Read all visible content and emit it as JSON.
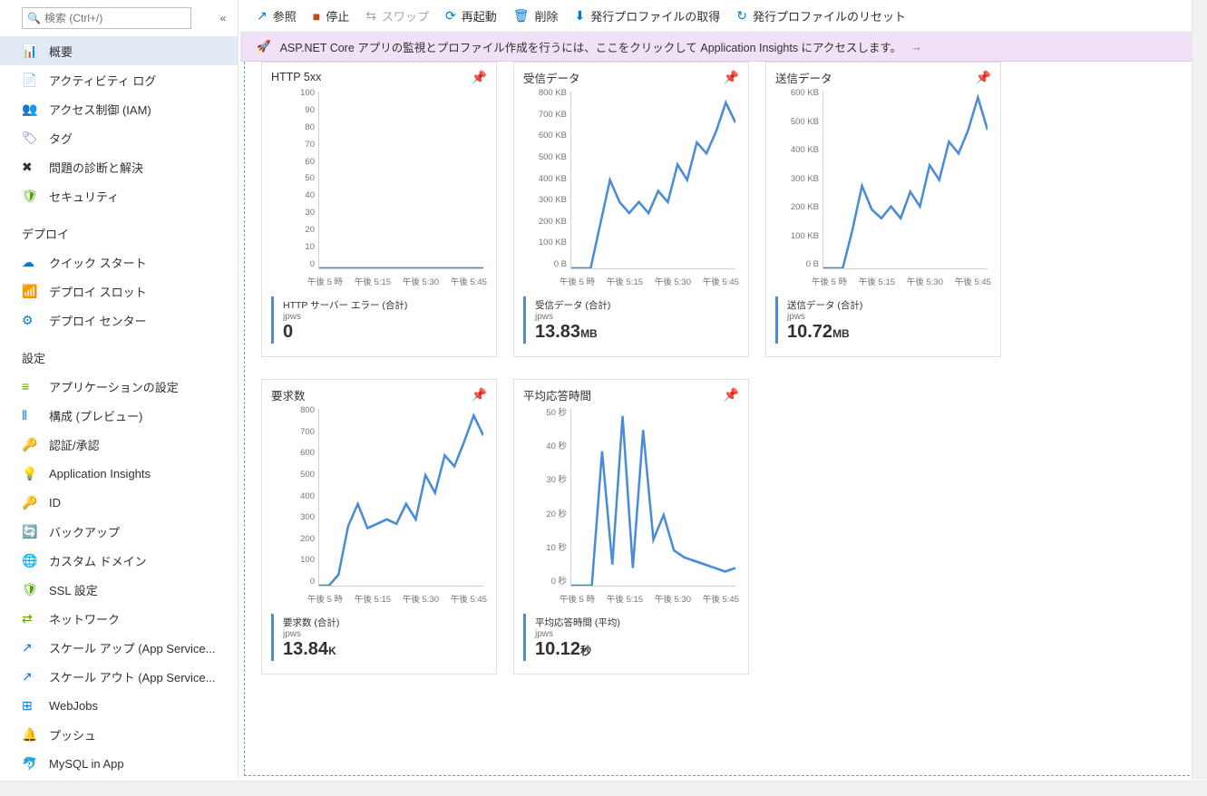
{
  "search": {
    "placeholder": "検索 (Ctrl+/)"
  },
  "sidebar": {
    "groups": [
      {
        "items": [
          {
            "icon": "📊",
            "color": "#0078d4",
            "label": "概要",
            "active": true
          },
          {
            "icon": "📄",
            "color": "#0078d4",
            "label": "アクティビティ ログ"
          },
          {
            "icon": "👥",
            "color": "#0078d4",
            "label": "アクセス制御 (IAM)"
          },
          {
            "icon": "🏷",
            "color": "#8661c5",
            "label": "タグ"
          },
          {
            "icon": "✖",
            "color": "#323130",
            "label": "問題の診断と解決"
          },
          {
            "icon": "🛡",
            "color": "#57a300",
            "label": "セキュリティ"
          }
        ]
      },
      {
        "title": "デプロイ",
        "items": [
          {
            "icon": "☁",
            "color": "#0078d4",
            "label": "クイック スタート"
          },
          {
            "icon": "📶",
            "color": "#ff8c00",
            "label": "デプロイ スロット"
          },
          {
            "icon": "⚙",
            "color": "#0078d4",
            "label": "デプロイ センター"
          }
        ]
      },
      {
        "title": "設定",
        "items": [
          {
            "icon": "≡",
            "color": "#57a300",
            "label": "アプリケーションの設定"
          },
          {
            "icon": "⦀",
            "color": "#0078d4",
            "label": "構成 (プレビュー)"
          },
          {
            "icon": "🔑",
            "color": "#ffb900",
            "label": "認証/承認"
          },
          {
            "icon": "💡",
            "color": "#8661c5",
            "label": "Application Insights"
          },
          {
            "icon": "🔑",
            "color": "#ffb900",
            "label": "ID"
          },
          {
            "icon": "🔄",
            "color": "#0078d4",
            "label": "バックアップ"
          },
          {
            "icon": "🌐",
            "color": "#0078d4",
            "label": "カスタム ドメイン"
          },
          {
            "icon": "🛡",
            "color": "#57a300",
            "label": "SSL 設定"
          },
          {
            "icon": "⇄",
            "color": "#57a300",
            "label": "ネットワーク"
          },
          {
            "icon": "↗",
            "color": "#0078d4",
            "label": "スケール アップ (App Service..."
          },
          {
            "icon": "↗",
            "color": "#0078d4",
            "label": "スケール アウト (App Service..."
          },
          {
            "icon": "⊞",
            "color": "#0078d4",
            "label": "WebJobs"
          },
          {
            "icon": "🔔",
            "color": "#ffb900",
            "label": "プッシュ"
          },
          {
            "icon": "🐬",
            "color": "#0078d4",
            "label": "MySQL in App"
          }
        ]
      }
    ]
  },
  "toolbar": {
    "browse": {
      "label": "参照"
    },
    "stop": {
      "label": "停止"
    },
    "swap": {
      "label": "スワップ",
      "disabled": true
    },
    "restart": {
      "label": "再起動"
    },
    "delete": {
      "label": "削除"
    },
    "getpub": {
      "label": "発行プロファイルの取得"
    },
    "resetpub": {
      "label": "発行プロファイルのリセット"
    }
  },
  "banner": {
    "text": "ASP.NET Core アプリの監視とプロファイル作成を行うには、ここをクリックして Application Insights にアクセスします。"
  },
  "charts": {
    "http5xx": {
      "title": "HTTP 5xx",
      "metric_label": "HTTP サーバー エラー (合計)",
      "resource": "jpws",
      "value": "0",
      "unit": ""
    },
    "datain": {
      "title": "受信データ",
      "metric_label": "受信データ (合計)",
      "resource": "jpws",
      "value": "13.83",
      "unit": "MB"
    },
    "dataout": {
      "title": "送信データ",
      "metric_label": "送信データ (合計)",
      "resource": "jpws",
      "value": "10.72",
      "unit": "MB"
    },
    "requests": {
      "title": "要求数",
      "metric_label": "要求数 (合計)",
      "resource": "jpws",
      "value": "13.84",
      "unit": "K"
    },
    "response": {
      "title": "平均応答時間",
      "metric_label": "平均応答時間 (平均)",
      "resource": "jpws",
      "value": "10.12",
      "unit": "秒"
    }
  },
  "chart_data": [
    {
      "id": "http5xx",
      "type": "line",
      "title": "HTTP 5xx",
      "ylabel": "",
      "xlabel": "",
      "ylim": [
        0,
        100
      ],
      "y_ticks": [
        100,
        90,
        80,
        70,
        60,
        50,
        40,
        30,
        20,
        10,
        0
      ],
      "x_ticks": [
        "午後 5 時",
        "午後 5:15",
        "午後 5:30",
        "午後 5:45"
      ],
      "x": [
        "17:00",
        "17:05",
        "17:10",
        "17:15",
        "17:20",
        "17:25",
        "17:30",
        "17:35",
        "17:40",
        "17:45",
        "17:50",
        "17:55"
      ],
      "values": [
        0,
        0,
        0,
        0,
        0,
        0,
        0,
        0,
        0,
        0,
        0,
        0
      ]
    },
    {
      "id": "datain",
      "type": "line",
      "title": "受信データ",
      "ylabel": "",
      "xlabel": "",
      "ylim": [
        0,
        800
      ],
      "y_ticks_labels": [
        "800 KB",
        "700 KB",
        "600 KB",
        "500 KB",
        "400 KB",
        "300 KB",
        "200 KB",
        "100 KB",
        "0 B"
      ],
      "x_ticks": [
        "午後 5 時",
        "午後 5:15",
        "午後 5:30",
        "午後 5:45"
      ],
      "x": [
        "17:00",
        "17:10",
        "17:15",
        "17:18",
        "17:20",
        "17:22",
        "17:25",
        "17:27",
        "17:30",
        "17:33",
        "17:35",
        "17:38",
        "17:40",
        "17:43",
        "17:45",
        "17:48",
        "17:50",
        "17:53"
      ],
      "values": [
        0,
        0,
        0,
        200,
        400,
        300,
        250,
        300,
        250,
        350,
        300,
        470,
        400,
        570,
        520,
        620,
        750,
        660
      ]
    },
    {
      "id": "dataout",
      "type": "line",
      "title": "送信データ",
      "ylabel": "",
      "xlabel": "",
      "ylim": [
        0,
        600
      ],
      "y_ticks_labels": [
        "600 KB",
        "500 KB",
        "400 KB",
        "300 KB",
        "200 KB",
        "100 KB",
        "0 B"
      ],
      "x_ticks": [
        "午後 5 時",
        "午後 5:15",
        "午後 5:30",
        "午後 5:45"
      ],
      "x": [
        "17:00",
        "17:10",
        "17:15",
        "17:18",
        "17:20",
        "17:22",
        "17:25",
        "17:27",
        "17:30",
        "17:33",
        "17:35",
        "17:38",
        "17:40",
        "17:43",
        "17:45",
        "17:48",
        "17:50",
        "17:53"
      ],
      "values": [
        0,
        0,
        0,
        130,
        280,
        200,
        170,
        210,
        170,
        260,
        210,
        350,
        300,
        430,
        390,
        470,
        580,
        470
      ]
    },
    {
      "id": "requests",
      "type": "line",
      "title": "要求数",
      "ylabel": "",
      "xlabel": "",
      "ylim": [
        0,
        800
      ],
      "y_ticks": [
        800,
        700,
        600,
        500,
        400,
        300,
        200,
        100,
        0
      ],
      "x_ticks": [
        "午後 5 時",
        "午後 5:15",
        "午後 5:30",
        "午後 5:45"
      ],
      "x": [
        "17:00",
        "17:10",
        "17:15",
        "17:18",
        "17:20",
        "17:22",
        "17:25",
        "17:27",
        "17:30",
        "17:33",
        "17:35",
        "17:38",
        "17:40",
        "17:43",
        "17:45",
        "17:48",
        "17:50",
        "17:53"
      ],
      "values": [
        0,
        0,
        50,
        270,
        370,
        260,
        280,
        300,
        280,
        370,
        300,
        500,
        420,
        590,
        540,
        650,
        770,
        680
      ]
    },
    {
      "id": "response",
      "type": "line",
      "title": "平均応答時間",
      "ylabel": "",
      "xlabel": "",
      "ylim": [
        0,
        50
      ],
      "y_ticks_labels": [
        "50 秒",
        "40 秒",
        "30 秒",
        "20 秒",
        "10 秒",
        "0 秒"
      ],
      "x_ticks": [
        "午後 5 時",
        "午後 5:15",
        "午後 5:30",
        "午後 5:45"
      ],
      "x": [
        "17:00",
        "17:10",
        "17:15",
        "17:17",
        "17:18",
        "17:20",
        "17:22",
        "17:24",
        "17:25",
        "17:27",
        "17:30",
        "17:33",
        "17:35",
        "17:40",
        "17:45",
        "17:50",
        "17:55"
      ],
      "values": [
        0,
        0,
        0,
        38,
        6,
        48,
        5,
        44,
        13,
        20,
        10,
        8,
        7,
        6,
        5,
        4,
        5
      ]
    }
  ]
}
